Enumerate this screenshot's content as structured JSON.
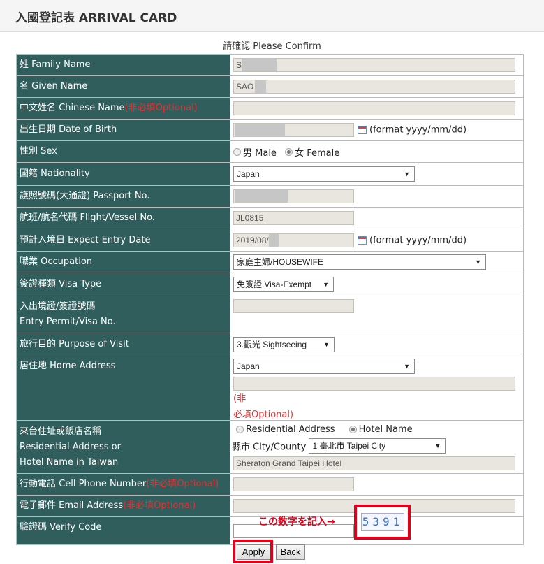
{
  "header": {
    "title": "入國登記表 ARRIVAL CARD"
  },
  "confirm_text": "請確認 Please Confirm",
  "fields": {
    "family_name": {
      "label": "姓 Family Name",
      "value": "S"
    },
    "given_name": {
      "label": "名 Given Name",
      "value": "SAO"
    },
    "chinese_name": {
      "label": "中文姓名 Chinese Name",
      "optional": "(非必填Optional)",
      "value": ""
    },
    "dob": {
      "label": "出生日期 Date of Birth",
      "value": "",
      "format": "(format yyyy/mm/dd)"
    },
    "sex": {
      "label": "性別 Sex",
      "options": [
        "男 Male",
        "女 Female"
      ],
      "selected": "女 Female"
    },
    "nationality": {
      "label": "國籍 Nationality",
      "value": "Japan"
    },
    "passport": {
      "label": "護照號碼(大通證) Passport No.",
      "value": ""
    },
    "flight": {
      "label": "航班/航名代碼 Flight/Vessel No.",
      "value": "JL0815"
    },
    "entry_date": {
      "label": "預計入境日 Expect Entry Date",
      "value": "2019/08/",
      "format": "(format yyyy/mm/dd)"
    },
    "occupation": {
      "label": "職業 Occupation",
      "value": "家庭主婦/HOUSEWIFE"
    },
    "visa_type": {
      "label": "簽證種類 Visa Type",
      "value": "免簽證 Visa-Exempt"
    },
    "entry_permit": {
      "label_line1": "入出境證/簽證號碼",
      "label_line2": "Entry Permit/Visa No.",
      "value": ""
    },
    "purpose": {
      "label": "旅行目的 Purpose of Visit",
      "value": "3.觀光 Sightseeing"
    },
    "home_address": {
      "label": "居住地 Home Address",
      "country": "Japan",
      "optional_a": "(非",
      "optional_b": "必填Optional)",
      "value": ""
    },
    "taiwan_address": {
      "label_line1": "來台住址或飯店名稱",
      "label_line2": "Residential Address or",
      "label_line3": "Hotel Name in Taiwan",
      "options": [
        "Residential Address",
        "Hotel Name"
      ],
      "selected": "Hotel Name",
      "city_label": "縣市 City/County",
      "city_value": "1 臺北市 Taipei City",
      "value": "Sheraton Grand Taipei Hotel"
    },
    "cell_phone": {
      "label": "行動電話 Cell Phone Number",
      "optional": "(非必填Optional)",
      "value": ""
    },
    "email": {
      "label": "電子郵件 Email Address",
      "optional": "(非必填Optional)",
      "value": ""
    },
    "verify_code": {
      "label": "驗證碼 Verify Code",
      "value": "",
      "captcha": "5391",
      "hint": "この数字を記入→"
    }
  },
  "buttons": {
    "apply": "Apply",
    "back": "Back"
  },
  "colors": {
    "label_bg": "#2f5e5c",
    "highlight": "#e3001b",
    "optional": "#e53030"
  }
}
